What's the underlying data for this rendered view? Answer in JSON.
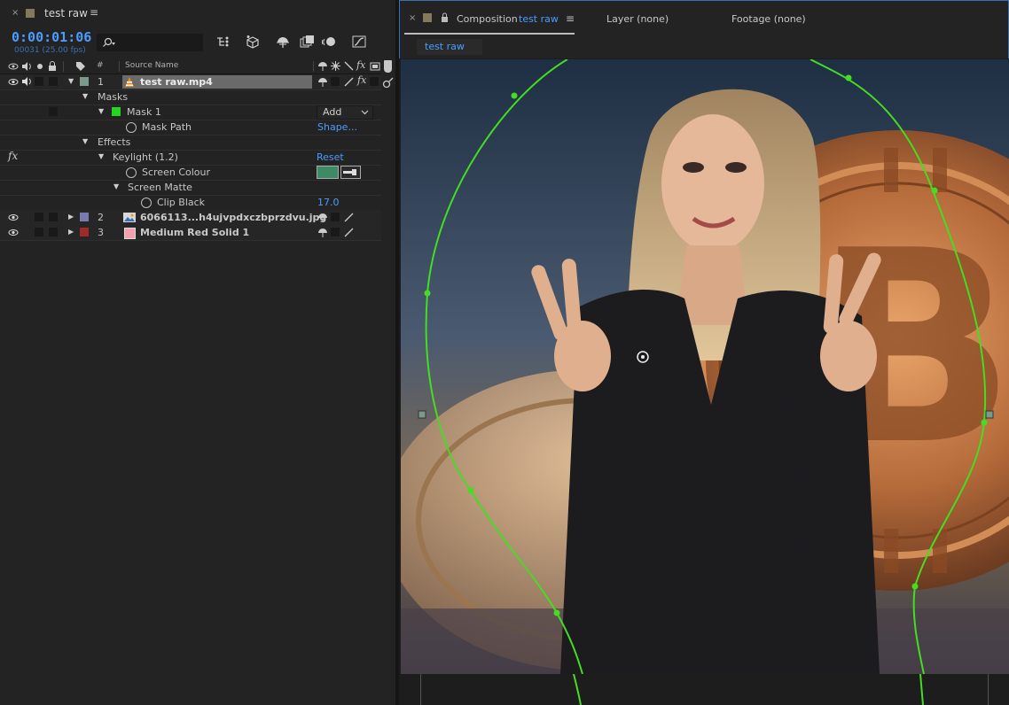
{
  "timeline_tab": {
    "close": "×",
    "title": "test raw",
    "menu": "≡"
  },
  "timecode": {
    "main": "0:00:01:06",
    "sub": "00031 (25.00 fps)"
  },
  "search": {
    "placeholder": ""
  },
  "columns": {
    "number": "#",
    "source_name": "Source Name"
  },
  "layers": [
    {
      "index": "1",
      "name": "test raw.mp4",
      "color": "#7a9a8c",
      "selected": true
    },
    {
      "index": "2",
      "name": "6066113...h4ujvpdxczbprzdvu.jpg",
      "color": "#7a7ab0"
    },
    {
      "index": "3",
      "name": "Medium Red Solid 1",
      "color": "#a02a2a"
    }
  ],
  "props": {
    "masks": "Masks",
    "mask1": "Mask 1",
    "mask1_color": "#22d622",
    "mask_mode": "Add",
    "mask_path": "Mask Path",
    "mask_path_value": "Shape...",
    "effects": "Effects",
    "fx_label": "fx",
    "keylight": "Keylight (1.2)",
    "reset": "Reset",
    "screen_colour": "Screen Colour",
    "screen_colour_value": "#3f8a66",
    "screen_matte": "Screen Matte",
    "clip_black": "Clip Black",
    "clip_black_value": "17.0"
  },
  "comp_tabs": {
    "close": "×",
    "composition_prefix": "Composition",
    "composition_name": "test raw",
    "menu": "≡",
    "layer": "Layer (none)",
    "footage": "Footage (none)",
    "subtab": "test raw"
  },
  "colors": {
    "accent": "#4a9dff",
    "mask_path": "#44dd22",
    "panel_bg": "#232323"
  }
}
